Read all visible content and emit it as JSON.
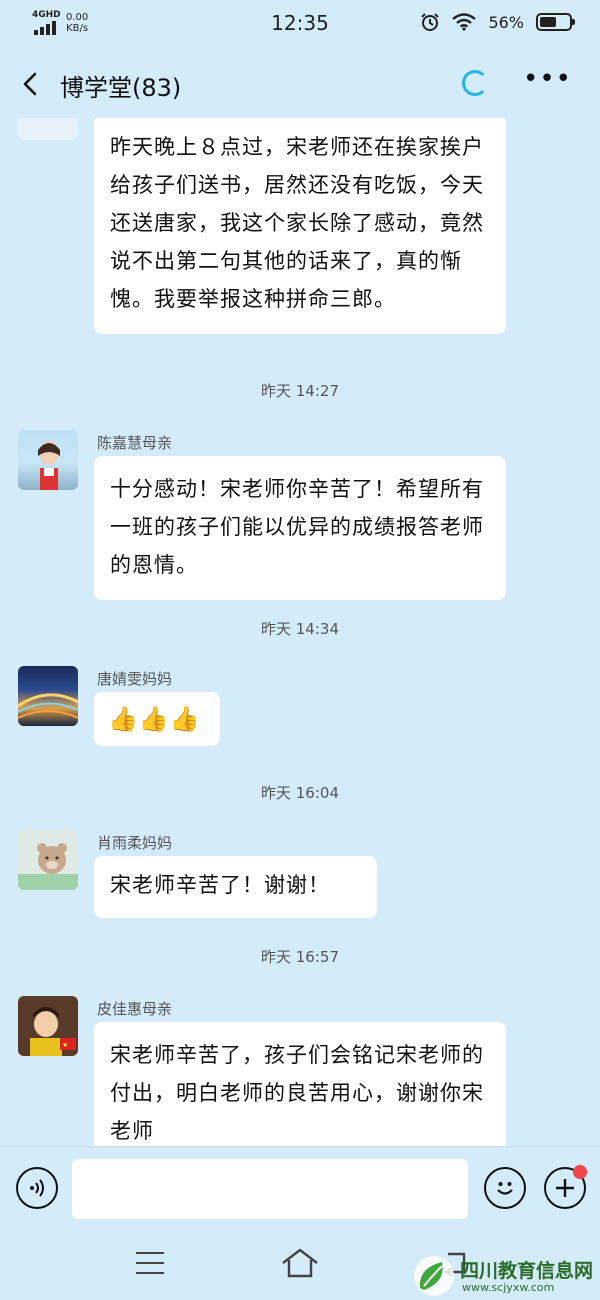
{
  "status_bar": {
    "network": "4GHD",
    "speed_value": "0.00",
    "speed_unit": "KB/s",
    "time": "12:35",
    "battery": "56%",
    "battery_level": 0.56
  },
  "header": {
    "title": "博学堂(83)",
    "back_icon": "chevron-left-icon",
    "sync_icon": "loading-ring-icon",
    "more_icon": "more-dots-icon"
  },
  "messages": [
    {
      "sender": "",
      "text": "昨天晚上８点过，宋老师还在挨家挨户给孩子们送书，居然还没有吃饭，今天还送唐家，我这个家长除了感动，竟然说不出第二句其他的话来了，真的惭愧。我要举报这种拼命三郎。"
    },
    {
      "time": "昨天 14:27",
      "sender": "陈嘉慧母亲",
      "text": "十分感动！宋老师你辛苦了！希望所有一班的孩子们能以优异的成绩报答老师的恩情。"
    },
    {
      "time": "昨天 14:34",
      "sender": "唐婧雯妈妈",
      "text": "👍👍👍"
    },
    {
      "time": "昨天 16:04",
      "sender": "肖雨柔妈妈",
      "text": "宋老师辛苦了！谢谢！"
    },
    {
      "time": "昨天 16:57",
      "sender": "皮佳惠母亲",
      "text": "宋老师辛苦了，孩子们会铭记宋老师的付出，明白老师的良苦用心，谢谢你宋老师"
    }
  ],
  "input": {
    "placeholder": "",
    "voice_icon": "voice-icon",
    "emoji_icon": "emoji-icon",
    "plus_icon": "plus-icon"
  },
  "watermark": {
    "title": "四川教育信息网",
    "url": "www.scjyxw.com"
  },
  "colors": {
    "background": "#d4ebfa",
    "bubble": "#ffffff",
    "accent": "#24b5ea",
    "badge": "#f34848"
  }
}
